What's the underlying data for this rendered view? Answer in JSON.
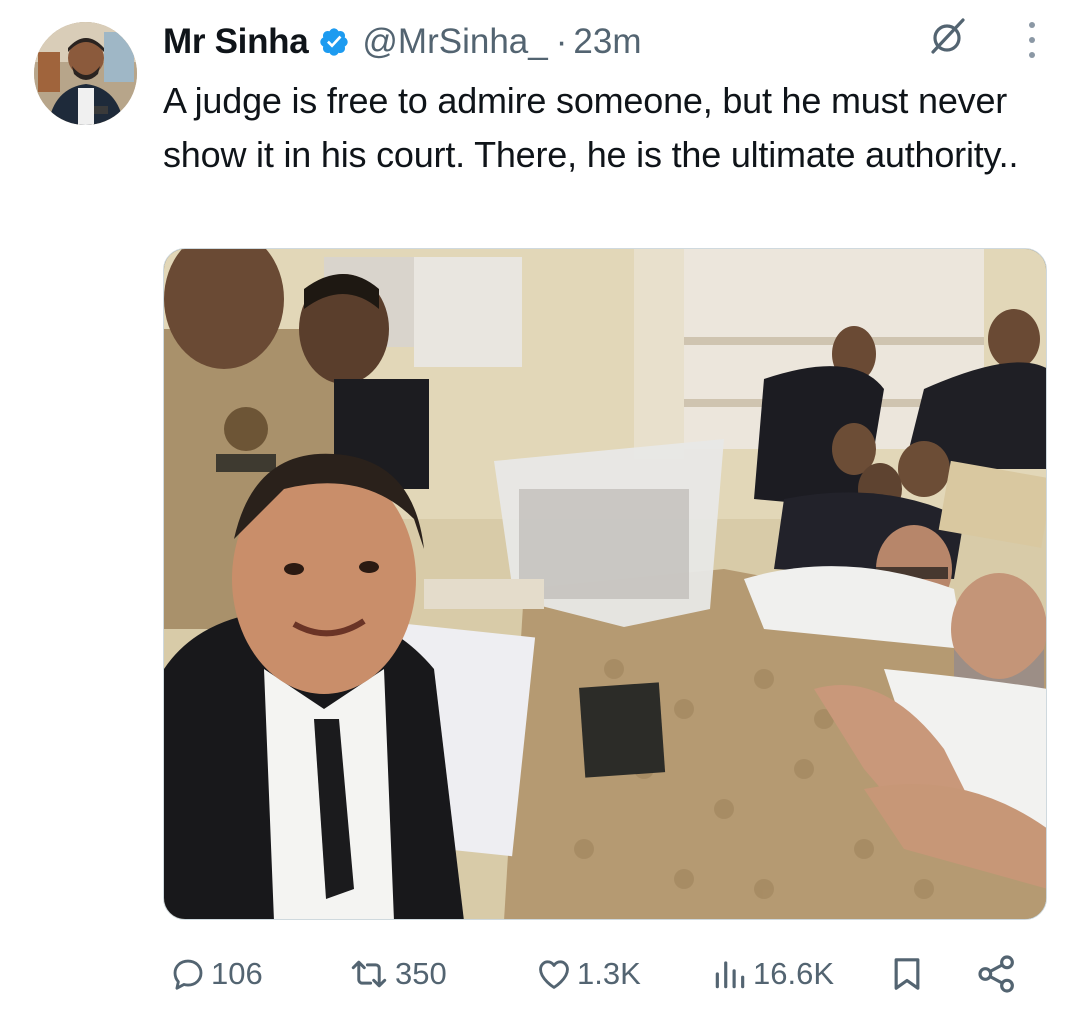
{
  "tweet": {
    "author_name": "Mr Sinha",
    "handle": "@MrSinha_",
    "separator": "·",
    "time": "23m",
    "text": "A judge is free to admire someone, but he must never show it in his court. There, he is the ultimate authority.."
  },
  "icons": {
    "verified": "verified-badge-icon",
    "grok": "grok-icon",
    "more": "more-options-icon",
    "reply": "reply-icon",
    "repost": "repost-icon",
    "like": "heart-icon",
    "views": "views-chart-icon",
    "bookmark": "bookmark-icon",
    "share": "share-icon"
  },
  "metrics": {
    "replies": "106",
    "reposts": "350",
    "likes": "1.3K",
    "views": "16.6K"
  },
  "colors": {
    "verified": "#1d9bf0",
    "text_primary": "#0f1419",
    "text_secondary": "#536471"
  }
}
